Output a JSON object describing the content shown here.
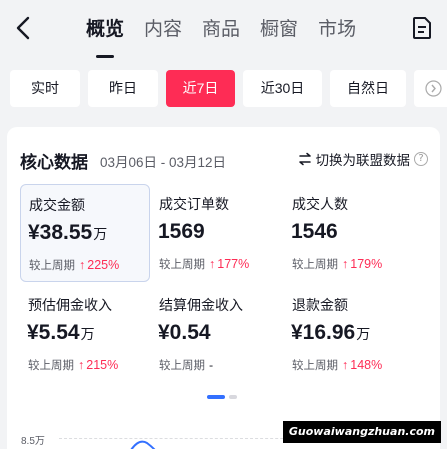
{
  "nav": {
    "tabs": [
      {
        "label": "概览",
        "active": true
      },
      {
        "label": "内容"
      },
      {
        "label": "商品"
      },
      {
        "label": "橱窗"
      },
      {
        "label": "市场"
      }
    ]
  },
  "filters": {
    "chips": [
      "实时",
      "昨日",
      "近7日",
      "近30日",
      "自然日"
    ],
    "active": "近7日"
  },
  "card": {
    "title": "核心数据",
    "date_range": "03月06日 - 03月12日",
    "switch_label": "切换为联盟数据",
    "help_icon": "?",
    "metrics": [
      {
        "label": "成交金额",
        "value": "¥38.55",
        "unit": "万",
        "cmp_label": "较上周期",
        "change": "225%"
      },
      {
        "label": "成交订单数",
        "value": "1569",
        "unit": "",
        "cmp_label": "较上周期",
        "change": "177%"
      },
      {
        "label": "成交人数",
        "value": "1546",
        "unit": "",
        "cmp_label": "较上周期",
        "change": "179%"
      },
      {
        "label": "预估佣金收入",
        "value": "¥5.54",
        "unit": "万",
        "cmp_label": "较上周期",
        "change": "215%"
      },
      {
        "label": "结算佣金收入",
        "value": "¥0.54",
        "unit": "",
        "cmp_label": "较上周期",
        "change": "-"
      },
      {
        "label": "退款金额",
        "value": "¥16.96",
        "unit": "万",
        "cmp_label": "较上周期",
        "change": "148%"
      }
    ],
    "chart_y_tick": "8.5万"
  },
  "watermark": "Guowaiwangzhuan.com",
  "colors": {
    "accent": "#fe2c55",
    "primary": "#3370ff"
  },
  "icons": {
    "back": "chevron-left-icon",
    "doc": "document-icon",
    "swap": "swap-icon",
    "more": "chevron-right-icon"
  }
}
